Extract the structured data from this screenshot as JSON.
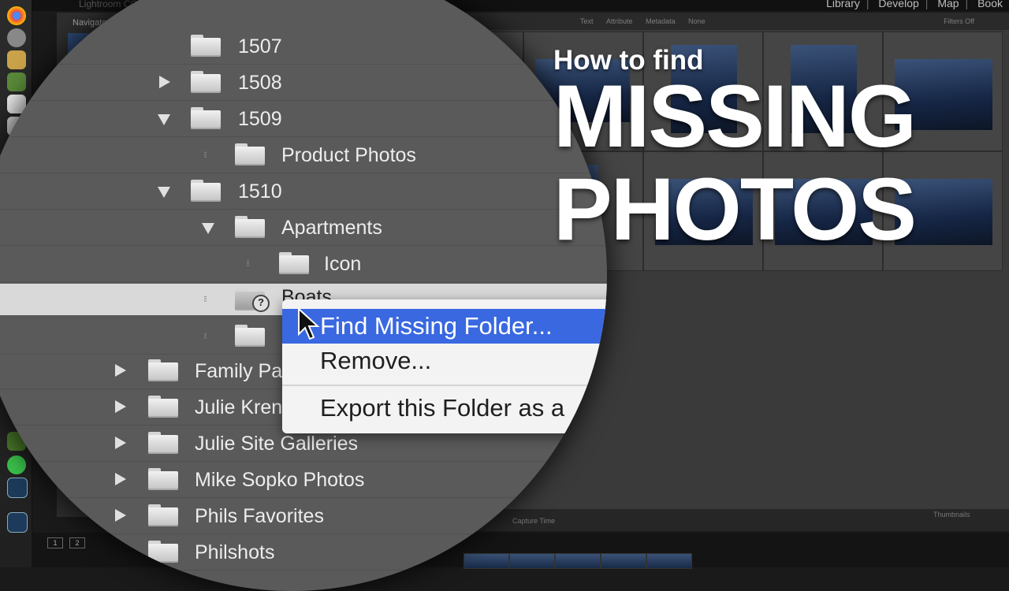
{
  "app": {
    "title": "Lightroom CC"
  },
  "modules": [
    "Library",
    "Develop",
    "Map",
    "Book"
  ],
  "left_panel": {
    "header": "Navigator"
  },
  "filter_bar": [
    "Text",
    "Attribute",
    "Metadata",
    "None",
    "Filters Off"
  ],
  "bottom_bar": {
    "sort_label": "Capture Time",
    "thumbnails_label": "Thumbnails"
  },
  "filmstrip": {
    "pages": [
      "1",
      "2"
    ]
  },
  "folders": [
    {
      "name": "1507",
      "state": "none"
    },
    {
      "name": "1508",
      "state": "collapsed"
    },
    {
      "name": "1509",
      "state": "expanded"
    },
    {
      "name": "Product Photos",
      "state": "leaf"
    },
    {
      "name": "1510",
      "state": "expanded"
    },
    {
      "name": "Apartments",
      "state": "expanded"
    },
    {
      "name": "Icon",
      "state": "leaf"
    },
    {
      "name": "Boats",
      "state": "leaf-missing"
    },
    {
      "name": "",
      "state": "leaf"
    },
    {
      "name": "Family Pa",
      "state": "collapsed"
    },
    {
      "name": "Julie Kren",
      "state": "collapsed"
    },
    {
      "name": "Julie Site Galleries",
      "state": "collapsed"
    },
    {
      "name": "Mike Sopko Photos",
      "state": "collapsed"
    },
    {
      "name": "Phils Favorites",
      "state": "collapsed"
    },
    {
      "name": "Philshots",
      "state": "collapsed"
    }
  ],
  "context_menu": {
    "items": [
      "Find Missing Folder...",
      "Remove...",
      "Export this Folder as a"
    ]
  },
  "headline": {
    "line1": "How to find",
    "line2": "MISSING",
    "line3": "PHOTOS"
  },
  "colors": {
    "menu_highlight": "#3968e0",
    "selected_row": "#d9d9d9"
  }
}
